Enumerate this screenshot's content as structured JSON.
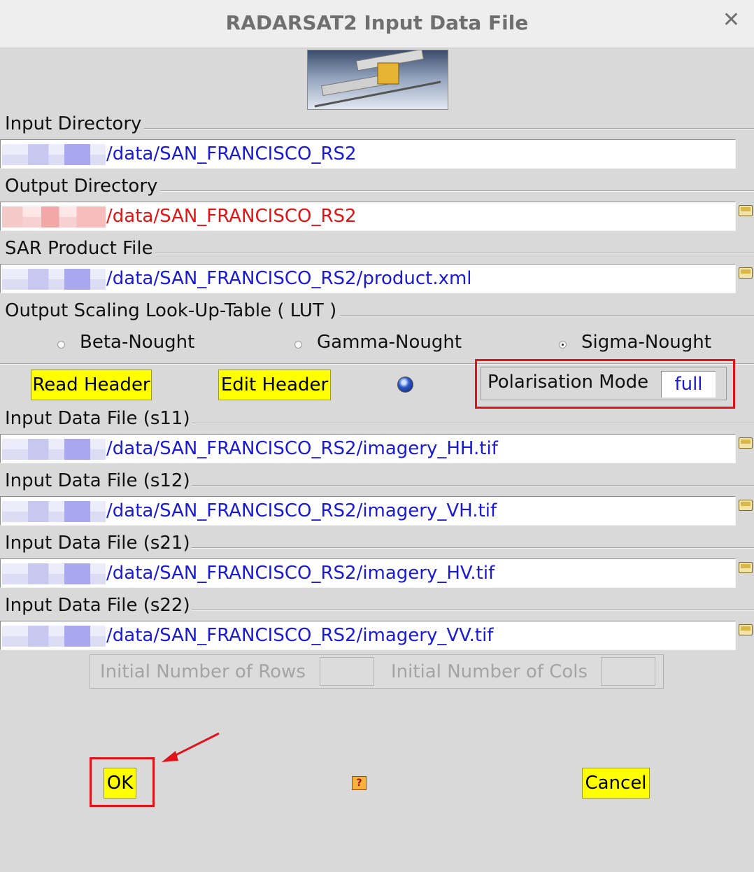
{
  "window": {
    "title": "RADARSAT2 Input Data File",
    "close_symbol": "✕"
  },
  "sections": {
    "input_dir": {
      "label": "Input Directory",
      "value": "/data/SAN_FRANCISCO_RS2"
    },
    "output_dir": {
      "label": "Output Directory",
      "value": "/data/SAN_FRANCISCO_RS2"
    },
    "product_file": {
      "label": "SAR Product File",
      "value": "/data/SAN_FRANCISCO_RS2/product.xml"
    },
    "lut": {
      "label": "Output Scaling Look-Up-Table ( LUT )",
      "options": [
        "Beta-Nought",
        "Gamma-Nought",
        "Sigma-Nought"
      ],
      "selected": "Sigma-Nought"
    },
    "s11": {
      "label": "Input Data File (s11)",
      "value": "/data/SAN_FRANCISCO_RS2/imagery_HH.tif"
    },
    "s12": {
      "label": "Input Data File (s12)",
      "value": "/data/SAN_FRANCISCO_RS2/imagery_VH.tif"
    },
    "s21": {
      "label": "Input Data File (s21)",
      "value": "/data/SAN_FRANCISCO_RS2/imagery_HV.tif"
    },
    "s22": {
      "label": "Input Data File (s22)",
      "value": "/data/SAN_FRANCISCO_RS2/imagery_VV.tif"
    }
  },
  "buttons": {
    "read_header": "Read Header",
    "edit_header": "Edit Header",
    "ok": "OK",
    "cancel": "Cancel"
  },
  "polarisation": {
    "label": "Polarisation Mode",
    "value": "full"
  },
  "dims": {
    "rows_label": "Initial Number of Rows",
    "cols_label": "Initial Number of Cols"
  },
  "colors": {
    "path_blue": "#1a1ad6",
    "path_red": "#e01414",
    "button_yellow": "#ffff00",
    "highlight_red": "#e0121a"
  },
  "icons": {
    "folder": "folder-icon",
    "globe": "globe-icon",
    "help": "help-icon",
    "close": "close-icon"
  }
}
